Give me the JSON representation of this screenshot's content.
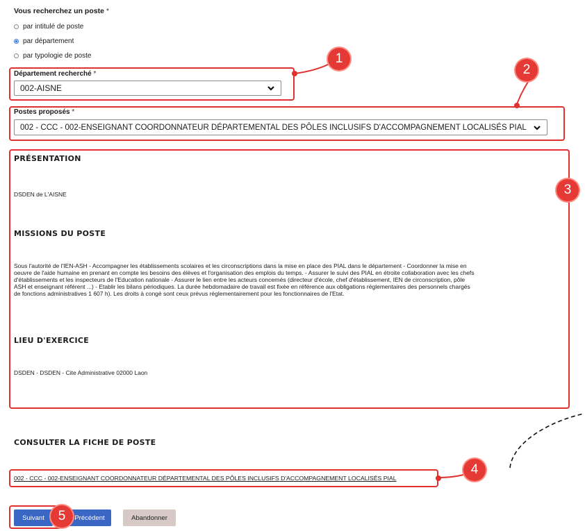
{
  "question": {
    "label": "Vous recherchez un poste",
    "required": "*"
  },
  "search_options": [
    {
      "label": "par intitulé de poste",
      "selected": false
    },
    {
      "label": "par département",
      "selected": true
    },
    {
      "label": "par typologie de poste",
      "selected": false
    }
  ],
  "department": {
    "label": "Département recherché",
    "required": "*",
    "value": "002-AISNE"
  },
  "postes": {
    "label": "Postes proposés",
    "required": "*",
    "value": "002 - CCC - 002-ENSEIGNANT COORDONNATEUR DÉPARTEMENTAL DES PÔLES INCLUSIFS D'ACCOMPAGNEMENT LOCALISÉS PIAL"
  },
  "details": {
    "presentation_title": "PRÉSENTATION",
    "presentation_text": "DSDEN de L'AISNE",
    "missions_title": "MISSIONS DU POSTE",
    "missions_lines": [
      "Sous l'autorité de l'IEN-ASH - Accompagner les établissements scolaires et les circonscriptions dans la mise en place des PIAL dans le département - Coordonner la mise en",
      "oeuvre de l'aide humaine en prenant en compte les besoins des élèves et l'organisation des emplois du temps. - Assurer le suivi des PIAL en étroite collaboration avec les chefs",
      "d'établissements et les inspecteurs de l'Education nationale - Assurer le lien entre les acteurs concernés (directeur d'école, chef d'établissement, IEN de circonscription, pôle",
      "ASH et enseignant référent ...) - Etablir les bilans périodiques. La durée hebdomadaire de travail est fixée en référence aux obligations réglementaires des personnels chargés",
      "de fonctions administratives 1 607 h). Les droits à congé sont ceux prévus réglementairement pour les fonctionnaires de l'Etat."
    ],
    "lieu_title": "LIEU D'EXERCICE",
    "lieu_text": "DSDEN - DSDEN - Cite Administrative 02000 Laon"
  },
  "fiche": {
    "title": "CONSULTER LA FICHE DE POSTE",
    "link": "002 - CCC - 002-ENSEIGNANT COORDONNATEUR DÉPARTEMENTAL DES PÔLES INCLUSIFS D'ACCOMPAGNEMENT LOCALISÉS PIAL"
  },
  "buttons": {
    "next": "Suivant",
    "previous": "Précédent",
    "cancel": "Abandonner"
  },
  "annotations": [
    "1",
    "2",
    "3",
    "4",
    "5"
  ],
  "colors": {
    "highlight": "#e03030",
    "badge": "#e53935",
    "primary_button": "#3a66c4",
    "secondary_button": "#d7c9c6",
    "radio_selected": "#2f6fd8"
  },
  "icons": [
    "chevron-down-icon",
    "chevron-down-icon",
    "dashed-arrow-icon"
  ]
}
